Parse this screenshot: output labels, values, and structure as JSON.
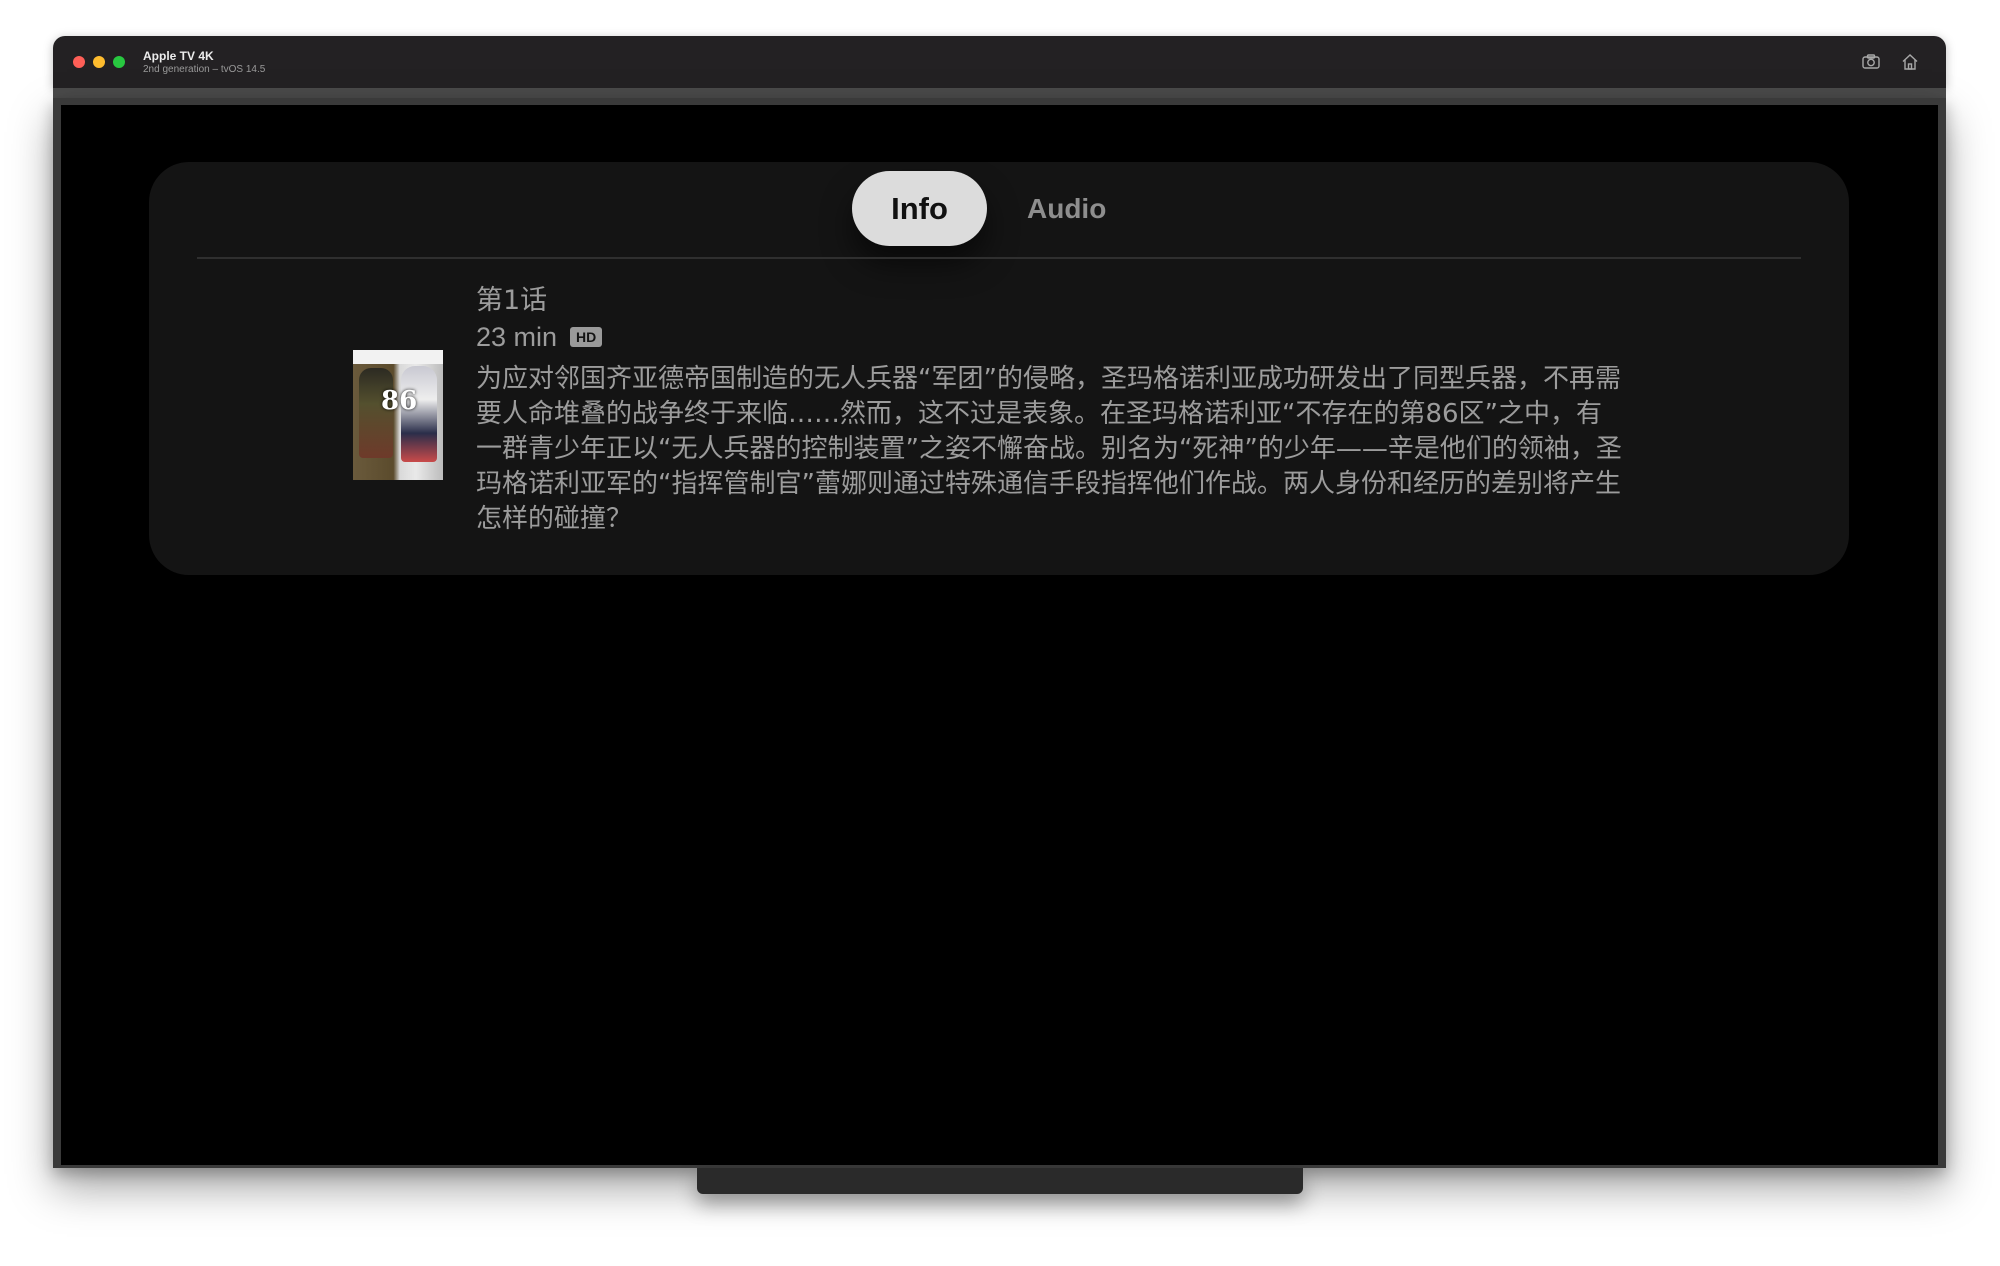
{
  "window": {
    "title": "Apple TV 4K",
    "subtitle": "2nd generation – tvOS 14.5",
    "toolbar": {
      "screenshot_icon": "camera-icon",
      "home_icon": "home-icon"
    }
  },
  "tabs": [
    {
      "label": "Info",
      "selected": true
    },
    {
      "label": "Audio",
      "selected": false
    }
  ],
  "episode": {
    "title": "第1话",
    "duration": "23 min",
    "badge": "HD",
    "poster_number": "86",
    "description": "为应对邻国齐亚德帝国制造的无人兵器“军团”的侵略，圣玛格诺利亚成功研发出了同型兵器，不再需要人命堆叠的战争终于来临……然而，这不过是表象。在圣玛格诺利亚“不存在的第86区”之中，有一群青少年正以“无人兵器的控制装置”之姿不懈奋战。别名为“死神”的少年——辛是他们的领袖，圣玛格诺利亚军的“指挥管制官”蕾娜则通过特殊通信手段指挥他们作战。两人身份和经历的差别将产生怎样的碰撞？"
  },
  "colors": {
    "screen_bg": "#000000",
    "panel_bg": "#141414",
    "tab_selected_bg": "#dcdcdc",
    "text_secondary": "#9c9c9c"
  }
}
